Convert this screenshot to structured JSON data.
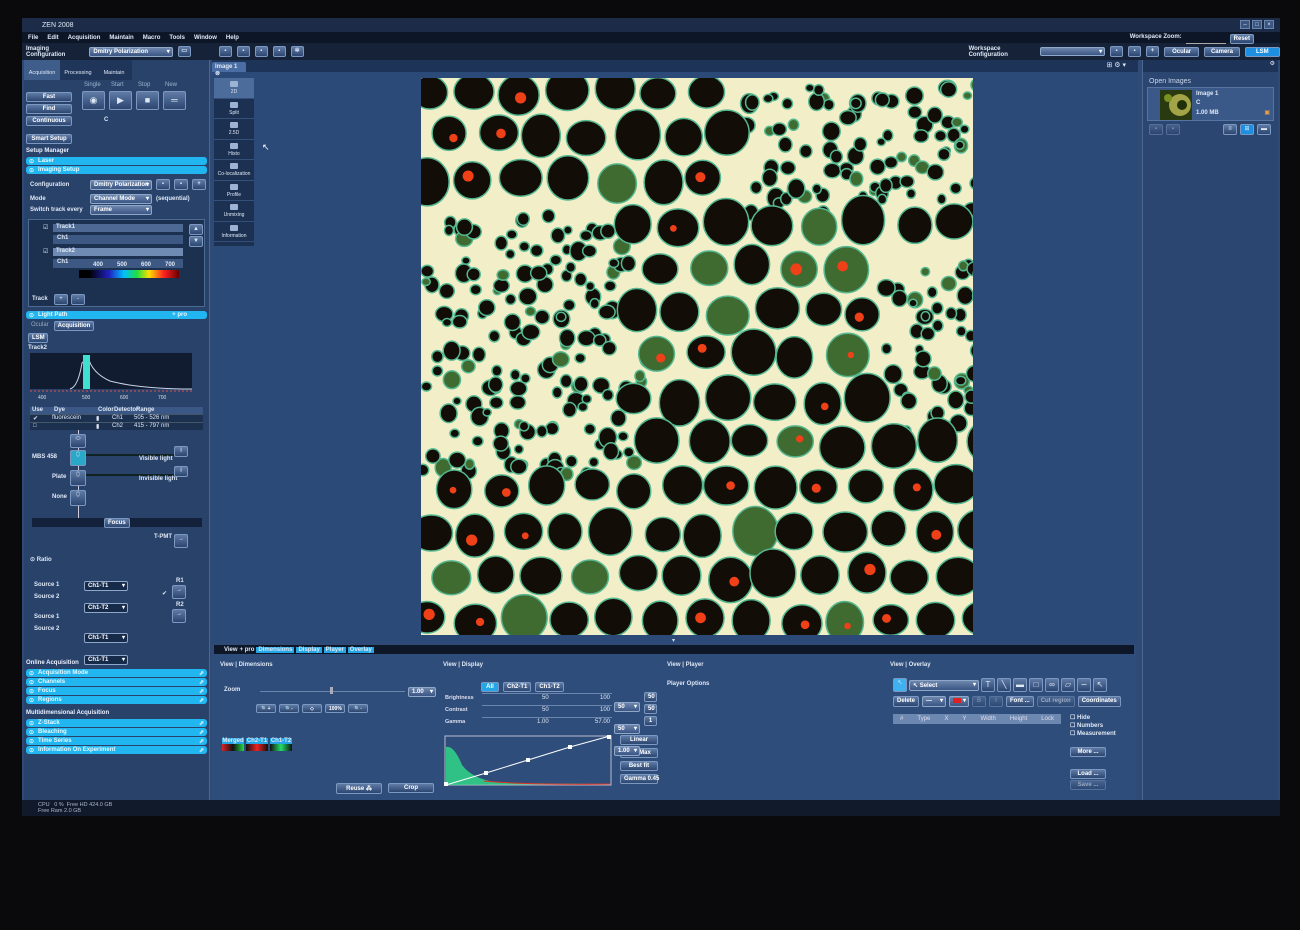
{
  "app": {
    "title": "ZEN 2008",
    "window_controls": [
      "–",
      "□",
      "×"
    ]
  },
  "menu": [
    "File",
    "Edit",
    "Acquisition",
    "Maintain",
    "Macro",
    "Tools",
    "Window",
    "Help"
  ],
  "toolbar": {
    "imaging_config_label": "Imaging Configuration",
    "imaging_config_value": "Dmitry Polarization",
    "workspace_config_label": "Workspace Configuration",
    "workspace_config_value": "",
    "workspace_zoom_label": "Workspace Zoom:",
    "reset_label": "Reset",
    "modes": [
      "Ocular",
      "Camera",
      "LSM"
    ],
    "active_mode": "LSM"
  },
  "left": {
    "tabs": [
      "Acquisition",
      "Processing",
      "Maintain"
    ],
    "acq_buttons": [
      "Fast",
      "Find",
      "Continuous"
    ],
    "scan_labels": [
      "Single",
      "Start",
      "Stop",
      "New"
    ],
    "c_label": "C",
    "smart_setup": "Smart Setup",
    "setup_manager": "Setup Manager",
    "setup_items": [
      "Laser",
      "Imaging Setup"
    ],
    "configuration_label": "Configuration",
    "configuration_value": "Dmitry Polarization",
    "mode_label": "Mode",
    "mode_value": "Channel Mode",
    "mode_note": "(sequential)",
    "switch_label": "Switch track every",
    "switch_value": "Frame",
    "tracks": [
      {
        "name": "Track1",
        "channel": "Ch1"
      },
      {
        "name": "Track2",
        "channel": "Ch1"
      }
    ],
    "spectrum_ticks": [
      "400",
      "500",
      "600",
      "700"
    ],
    "track_label": "Track",
    "light_path": "Light Path",
    "light_path_extra": "+ pro",
    "lp_tabs": [
      "Ocular",
      "Acquisition"
    ],
    "lsm_tab": "LSM",
    "track2": "Track2",
    "plot_ticks": [
      "400",
      "500",
      "600",
      "700"
    ],
    "det_headers": [
      "Use",
      "Dye",
      "Color",
      "Detector",
      "Range"
    ],
    "det_rows": [
      {
        "dye": "fluorescein",
        "detector": "Ch1",
        "range": "505 - 526 nm"
      },
      {
        "dye": "",
        "detector": "Ch2",
        "range": "415 - 797 nm"
      }
    ],
    "filters": [
      "MBS 458",
      "Plate",
      "None"
    ],
    "visible_light": "Visible light",
    "invisible_light": "Invisible light",
    "focus": "Focus",
    "tpmt": "T-PMT",
    "ratio": "Ratio",
    "r1": "R1",
    "r2": "R2",
    "sources": [
      {
        "label": "Source 1",
        "value": "Ch1-T1"
      },
      {
        "label": "Source 2",
        "value": "Ch1-T2"
      },
      {
        "label": "Source 1",
        "value": "Ch1-T1"
      },
      {
        "label": "Source 2",
        "value": "Ch1-T1"
      }
    ],
    "online_acq": "Online Acquisition",
    "online_items": [
      "Acquisition Mode",
      "Channels",
      "Focus",
      "Regions"
    ],
    "multi_acq": "Multidimensional Acquisition",
    "multi_items": [
      "Z-Stack",
      "Bleaching",
      "Time Series",
      "Information On Experiment"
    ]
  },
  "view": {
    "image_tab": "Image 1",
    "tools": [
      "2D",
      "Split",
      "2.5D",
      "Histo",
      "Co-localization",
      "Profile",
      "Unmixing",
      "Information"
    ],
    "active_tool": "2D"
  },
  "bottom": {
    "tabs": [
      "View",
      "+ pro",
      "Dimensions",
      "Display",
      "Player",
      "Overlay"
    ],
    "dimensions": {
      "title": "View | Dimensions",
      "zoom_label": "Zoom",
      "zoom_value": "1.00",
      "zoom_buttons": [
        "zoom-in",
        "zoom-out",
        "fit",
        "100%",
        "zoom-select"
      ],
      "channels": [
        "Merged",
        "Ch2-T1",
        "Ch1-T2"
      ],
      "reuse": "Reuse",
      "crop": "Crop"
    },
    "display": {
      "title": "View | Display",
      "channel_tabs": [
        "All",
        "Ch2-T1",
        "Ch1-T2"
      ],
      "brightness": {
        "label": "Brightness",
        "value": "50",
        "max": "100",
        "reset": "50"
      },
      "contrast": {
        "label": "Contrast",
        "value": "50",
        "max": "100",
        "reset": "50"
      },
      "gamma": {
        "label": "Gamma",
        "value": "1.00",
        "max": "57.00",
        "reset": "1"
      },
      "buttons": [
        "Linear",
        "Min/Max",
        "Best fit",
        "Gamma 0.45"
      ]
    },
    "player": {
      "title": "View | Player",
      "options": "Player Options"
    },
    "overlay": {
      "title": "View | Overlay",
      "select": "Select",
      "delete": "Delete",
      "font": "Font ...",
      "cut_region": "Cut region",
      "coordinates": "Coordinates",
      "headers": [
        "#",
        "Type",
        "X",
        "Y",
        "Width",
        "Height",
        "Lock"
      ],
      "checks": [
        "Hide",
        "Numbers",
        "Measurement"
      ],
      "more": "More ...",
      "load": "Load ...",
      "save": "Save ..."
    }
  },
  "right": {
    "title": "Open Images",
    "image": {
      "name": "Image 1",
      "channel": "C",
      "size": "1.00 MB"
    }
  },
  "status": {
    "cpu_label": "CPU",
    "cpu": "0 %",
    "free_hd": "Free HD 424.0 GB",
    "free_ram": "Free Ram 2.0 GB"
  },
  "colors": {
    "accent": "#21b6ef",
    "panel": "#28426a",
    "background": "#2f4a74"
  }
}
